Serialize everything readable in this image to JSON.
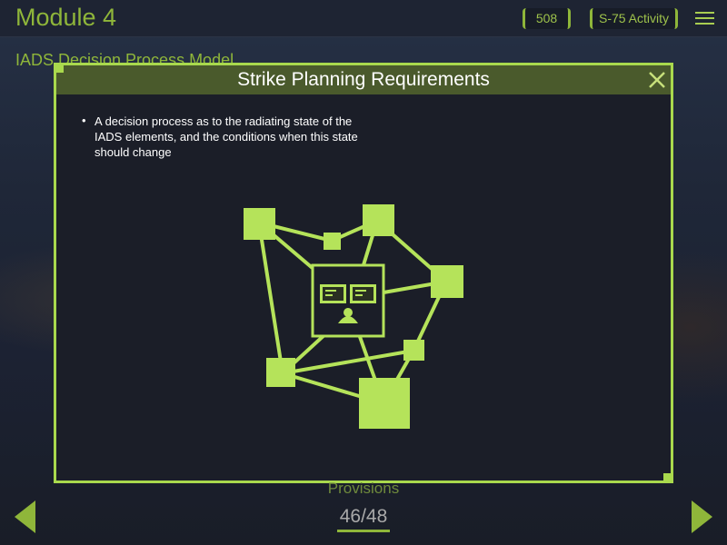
{
  "header": {
    "module_title": "Module 4",
    "count_badge": "508",
    "activity_button": "S-75 Activity",
    "menu_icon": "hamburger-menu-icon"
  },
  "section_title": "IADS Decision Process Model",
  "modal": {
    "title": "Strike Planning Requirements",
    "close_icon": "close-x-icon",
    "bullet": "A decision process as to the radiating state of the IADS elements, and the conditions when this state should change"
  },
  "diagram": {
    "center_icon": "operator-at-console-icon",
    "node_icons": "square-node-icon"
  },
  "footer": {
    "provisions_label": "Provisions",
    "page_indicator": "46/48",
    "prev_icon": "left-arrow-icon",
    "next_icon": "right-arrow-icon"
  },
  "colors": {
    "accent": "#a9d94d",
    "accent_dark": "#8fb63a",
    "header_bar": "#4a5a2c",
    "panel_bg": "#1b1e28"
  }
}
